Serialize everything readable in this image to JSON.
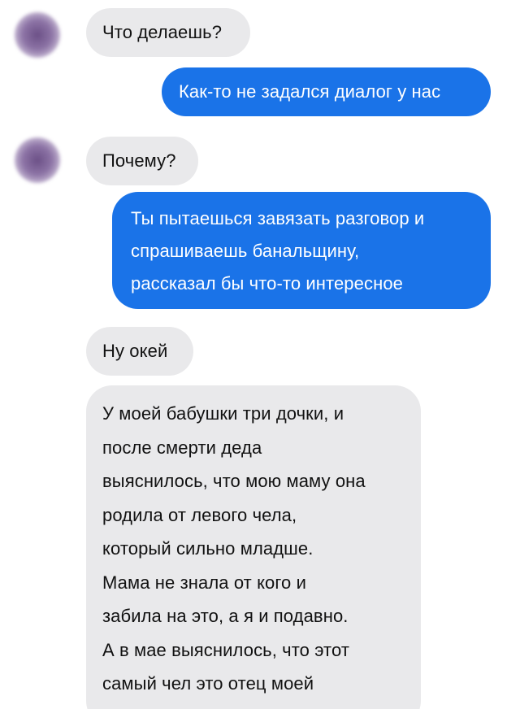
{
  "conversation": {
    "messages": [
      {
        "sender": "contact",
        "lines": [
          "Что делаешь?"
        ]
      },
      {
        "sender": "me",
        "lines": [
          "Как-то не задался диалог у нас"
        ]
      },
      {
        "sender": "contact",
        "lines": [
          "Почему?"
        ]
      },
      {
        "sender": "me",
        "lines": [
          "Ты пытаешься завязать разговор и",
          "спрашиваешь банальщину,",
          "рассказал бы что-то интересное"
        ]
      },
      {
        "sender": "contact",
        "lines": [
          "Ну окей"
        ]
      },
      {
        "sender": "contact",
        "lines": [
          "У моей бабушки три дочки, и",
          "после смерти деда",
          "выяснилось, что мою маму она",
          "родила от левого чела,",
          "который сильно младше.",
          "Мама не знала от кого и",
          "забила на это, а я и подавно.",
          "А в мае выяснилось, что этот",
          "самый чел это отец моей"
        ]
      }
    ]
  },
  "colors": {
    "outgoing_bubble": "#1a73e8",
    "incoming_bubble": "#e9e9eb",
    "outgoing_text": "#ffffff",
    "incoming_text": "#111111"
  }
}
